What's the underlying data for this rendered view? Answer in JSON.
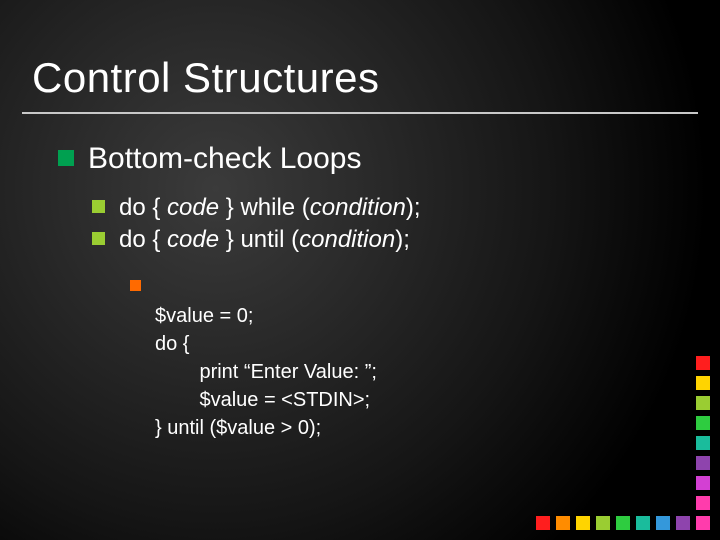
{
  "title": "Control Structures",
  "bullets": {
    "l1": "Bottom-check Loops",
    "l2": [
      {
        "pre": "do { ",
        "code": "code",
        "mid": " } while (",
        "cond": "condition",
        "post": ");"
      },
      {
        "pre": "do { ",
        "code": "code",
        "mid": " } until (",
        "cond": "condition",
        "post": ");"
      }
    ],
    "l3": {
      "first": "$value = 0;",
      "lines": [
        "do {",
        "        print “Enter Value: ”;",
        "        $value = <STDIN>;",
        "} until ($value > 0);"
      ]
    }
  },
  "deco": {
    "bottom": [
      "#ff1e1e",
      "#ff8c00",
      "#ffd400",
      "#9acd32",
      "#2ecc40",
      "#1abc9c",
      "#3498db",
      "#8e44ad",
      "#ff3cac"
    ],
    "right": [
      "#ff3cac",
      "#ff3cac",
      "#d340d3",
      "#8e44ad",
      "#1abc9c",
      "#2ecc40",
      "#9acd32",
      "#ffd400",
      "#ff1e1e"
    ]
  }
}
